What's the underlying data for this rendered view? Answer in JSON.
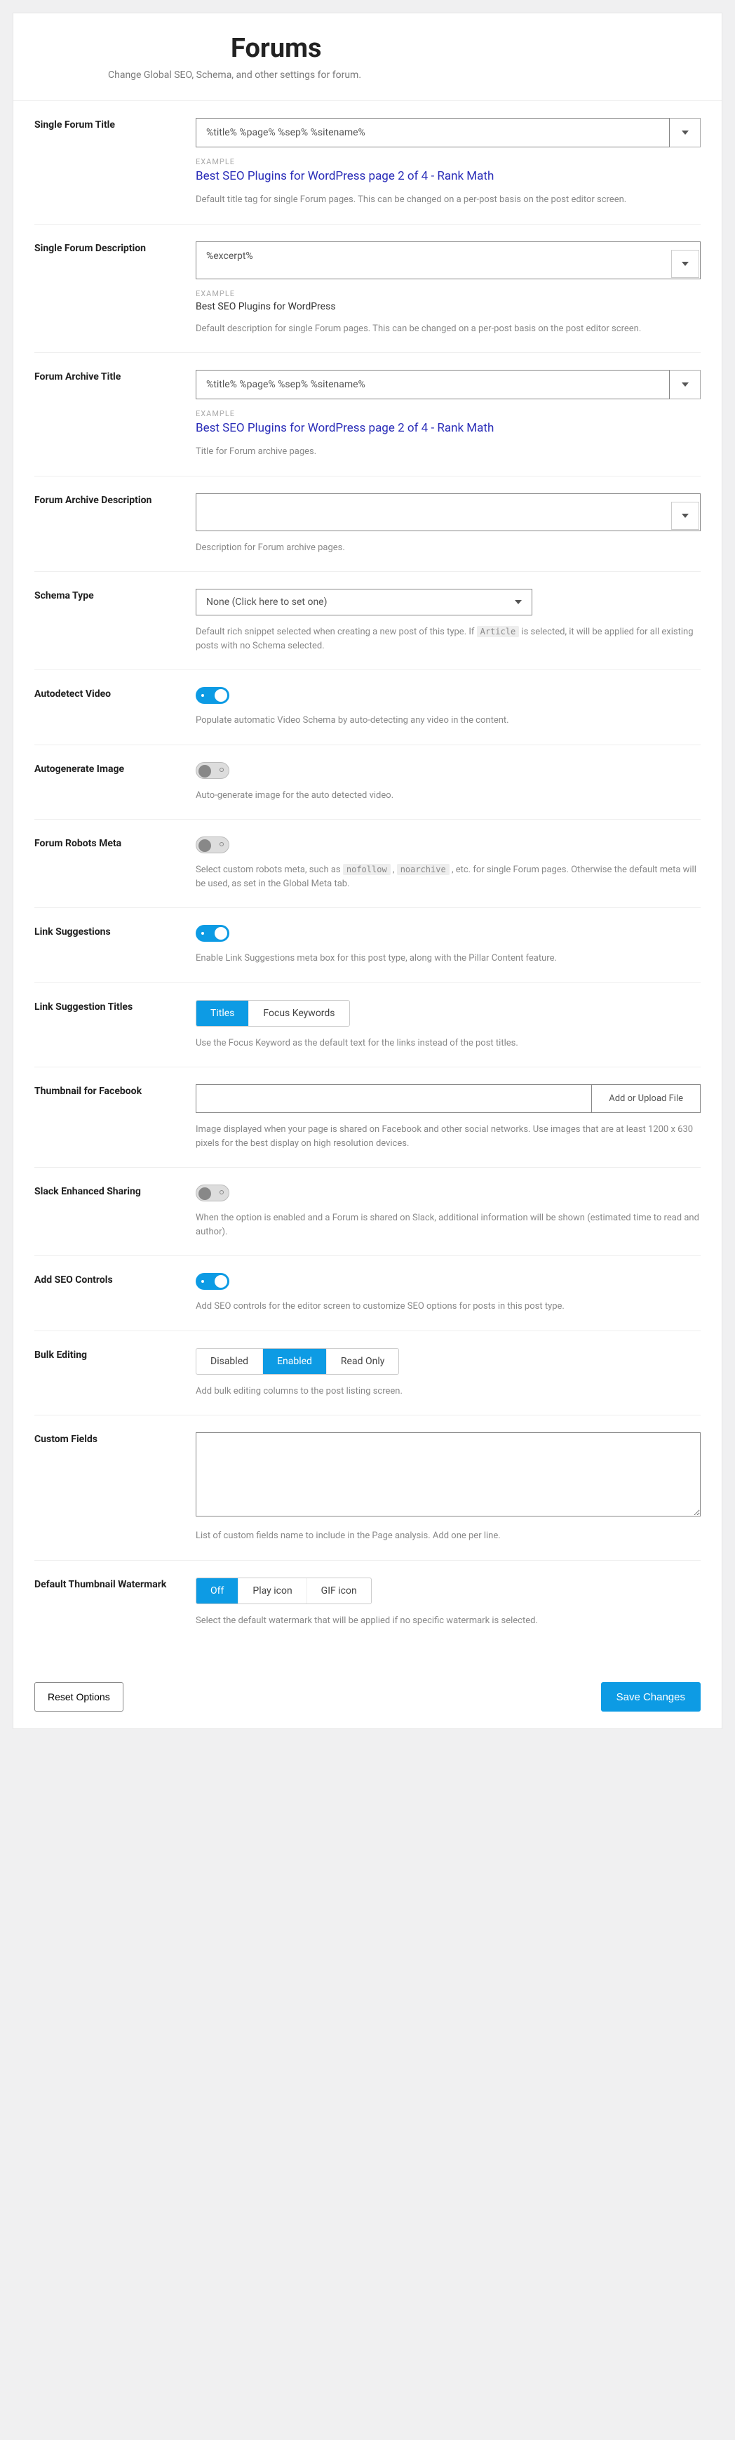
{
  "header": {
    "title": "Forums",
    "subtitle": "Change Global SEO, Schema, and other settings for forum."
  },
  "single_forum_title": {
    "label": "Single Forum Title",
    "value": "%title% %page% %sep% %sitename%",
    "example_label": "EXAMPLE",
    "example": "Best SEO Plugins for WordPress page 2 of 4 - Rank Math",
    "help": "Default title tag for single Forum pages. This can be changed on a per-post basis on the post editor screen."
  },
  "single_forum_desc": {
    "label": "Single Forum Description",
    "value": "%excerpt%",
    "example_label": "EXAMPLE",
    "example": "Best SEO Plugins for WordPress",
    "help": "Default description for single Forum pages. This can be changed on a per-post basis on the post editor screen."
  },
  "forum_archive_title": {
    "label": "Forum Archive Title",
    "value": "%title% %page% %sep% %sitename%",
    "example_label": "EXAMPLE",
    "example": "Best SEO Plugins for WordPress page 2 of 4 - Rank Math",
    "help": "Title for Forum archive pages."
  },
  "forum_archive_desc": {
    "label": "Forum Archive Description",
    "value": "",
    "help": "Description for Forum archive pages."
  },
  "schema_type": {
    "label": "Schema Type",
    "selected": "None (Click here to set one)",
    "help_pre": "Default rich snippet selected when creating a new post of this type. If ",
    "help_code": "Article",
    "help_post": " is selected, it will be applied for all existing posts with no Schema selected."
  },
  "autodetect_video": {
    "label": "Autodetect Video",
    "on": true,
    "help": "Populate automatic Video Schema by auto-detecting any video in the content."
  },
  "autogenerate_image": {
    "label": "Autogenerate Image",
    "on": false,
    "help": "Auto-generate image for the auto detected video."
  },
  "forum_robots": {
    "label": "Forum Robots Meta",
    "on": false,
    "help_pre": "Select custom robots meta, such as ",
    "help_c1": "nofollow",
    "help_mid": " , ",
    "help_c2": "noarchive",
    "help_post": " , etc. for single Forum pages. Otherwise the default meta will be used, as set in the Global Meta tab."
  },
  "link_suggestions": {
    "label": "Link Suggestions",
    "on": true,
    "help": "Enable Link Suggestions meta box for this post type, along with the Pillar Content feature."
  },
  "link_suggestion_titles": {
    "label": "Link Suggestion Titles",
    "opt1": "Titles",
    "opt2": "Focus Keywords",
    "help": "Use the Focus Keyword as the default text for the links instead of the post titles."
  },
  "thumbnail_fb": {
    "label": "Thumbnail for Facebook",
    "button": "Add or Upload File",
    "help": "Image displayed when your page is shared on Facebook and other social networks. Use images that are at least 1200 x 630 pixels for the best display on high resolution devices."
  },
  "slack": {
    "label": "Slack Enhanced Sharing",
    "on": false,
    "help": "When the option is enabled and a Forum is shared on Slack, additional information will be shown (estimated time to read and author)."
  },
  "seo_controls": {
    "label": "Add SEO Controls",
    "on": true,
    "help": "Add SEO controls for the editor screen to customize SEO options for posts in this post type."
  },
  "bulk_editing": {
    "label": "Bulk Editing",
    "opt1": "Disabled",
    "opt2": "Enabled",
    "opt3": "Read Only",
    "help": "Add bulk editing columns to the post listing screen."
  },
  "custom_fields": {
    "label": "Custom Fields",
    "help": "List of custom fields name to include in the Page analysis. Add one per line."
  },
  "watermark": {
    "label": "Default Thumbnail Watermark",
    "opt1": "Off",
    "opt2": "Play icon",
    "opt3": "GIF icon",
    "help": "Select the default watermark that will be applied if no specific watermark is selected."
  },
  "footer": {
    "reset": "Reset Options",
    "save": "Save Changes"
  }
}
